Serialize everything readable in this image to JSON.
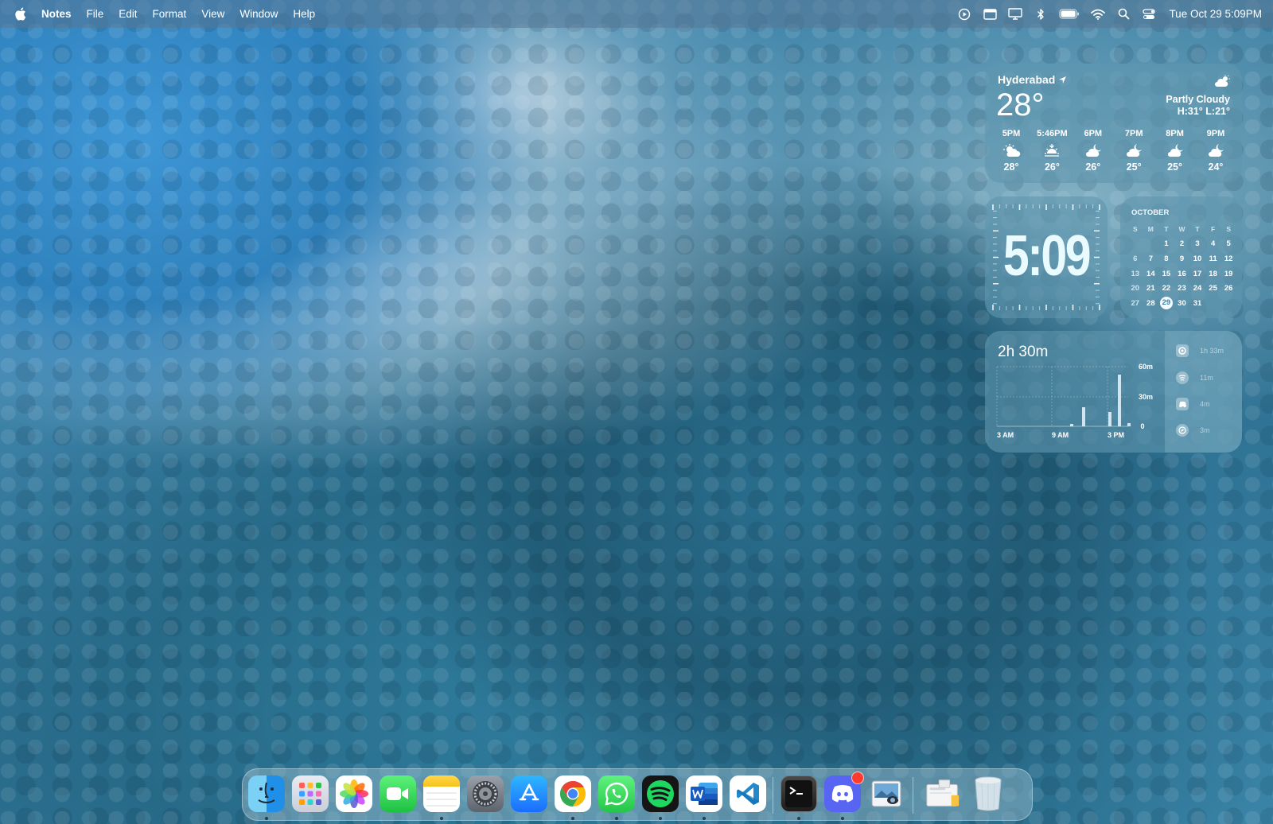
{
  "menubar": {
    "app_name": "Notes",
    "menus": [
      "File",
      "Edit",
      "Format",
      "View",
      "Window",
      "Help"
    ],
    "clock": "Tue Oct 29  5:09PM",
    "status_icons": [
      "play-circle-icon",
      "window-icon",
      "display-icon",
      "bluetooth-icon",
      "battery-icon",
      "wifi-icon",
      "search-icon",
      "control-center-icon"
    ]
  },
  "weather": {
    "city": "Hyderabad",
    "temperature": "28°",
    "condition": "Partly Cloudy",
    "high_low": "H:31° L:21°",
    "hourly": [
      {
        "time": "5PM",
        "icon": "sun-cloud-icon",
        "temp": "28°"
      },
      {
        "time": "5:46PM",
        "icon": "sunset-icon",
        "temp": "26°"
      },
      {
        "time": "6PM",
        "icon": "moon-cloud-icon",
        "temp": "26°"
      },
      {
        "time": "7PM",
        "icon": "moon-cloud-icon",
        "temp": "25°"
      },
      {
        "time": "8PM",
        "icon": "moon-cloud-icon",
        "temp": "25°"
      },
      {
        "time": "9PM",
        "icon": "moon-cloud-icon",
        "temp": "24°"
      }
    ]
  },
  "clock_widget": {
    "time": "5:09"
  },
  "calendar": {
    "month": "OCTOBER",
    "weekdays": [
      "S",
      "M",
      "T",
      "W",
      "T",
      "F",
      "S"
    ],
    "weeks": [
      [
        "",
        "",
        "1",
        "2",
        "3",
        "4",
        "5"
      ],
      [
        "6",
        "7",
        "8",
        "9",
        "10",
        "11",
        "12"
      ],
      [
        "13",
        "14",
        "15",
        "16",
        "17",
        "18",
        "19"
      ],
      [
        "20",
        "21",
        "22",
        "23",
        "24",
        "25",
        "26"
      ],
      [
        "27",
        "28",
        "29",
        "30",
        "31",
        "",
        ""
      ]
    ],
    "today": "29"
  },
  "screen_time": {
    "total": "2h 30m",
    "chart_labels": {
      "x": [
        "3 AM",
        "9 AM",
        "3 PM"
      ],
      "y": [
        "60m",
        "30m",
        "0"
      ]
    },
    "apps": [
      {
        "name": "chrome-icon",
        "time": "1h 33m"
      },
      {
        "name": "spotify-icon",
        "time": "11m"
      },
      {
        "name": "discord-icon",
        "time": "4m"
      },
      {
        "name": "safari-icon",
        "time": "3m"
      }
    ]
  },
  "dock": {
    "apps": [
      "finder-icon",
      "launchpad-icon",
      "photos-icon",
      "facetime-icon",
      "notes-icon",
      "system-settings-icon",
      "app-store-icon",
      "chrome-icon",
      "whatsapp-icon",
      "spotify-icon",
      "word-icon",
      "vscode-icon",
      "terminal-icon",
      "discord-icon",
      "preview-icon",
      "downloads-folder-icon",
      "trash-icon"
    ]
  }
}
